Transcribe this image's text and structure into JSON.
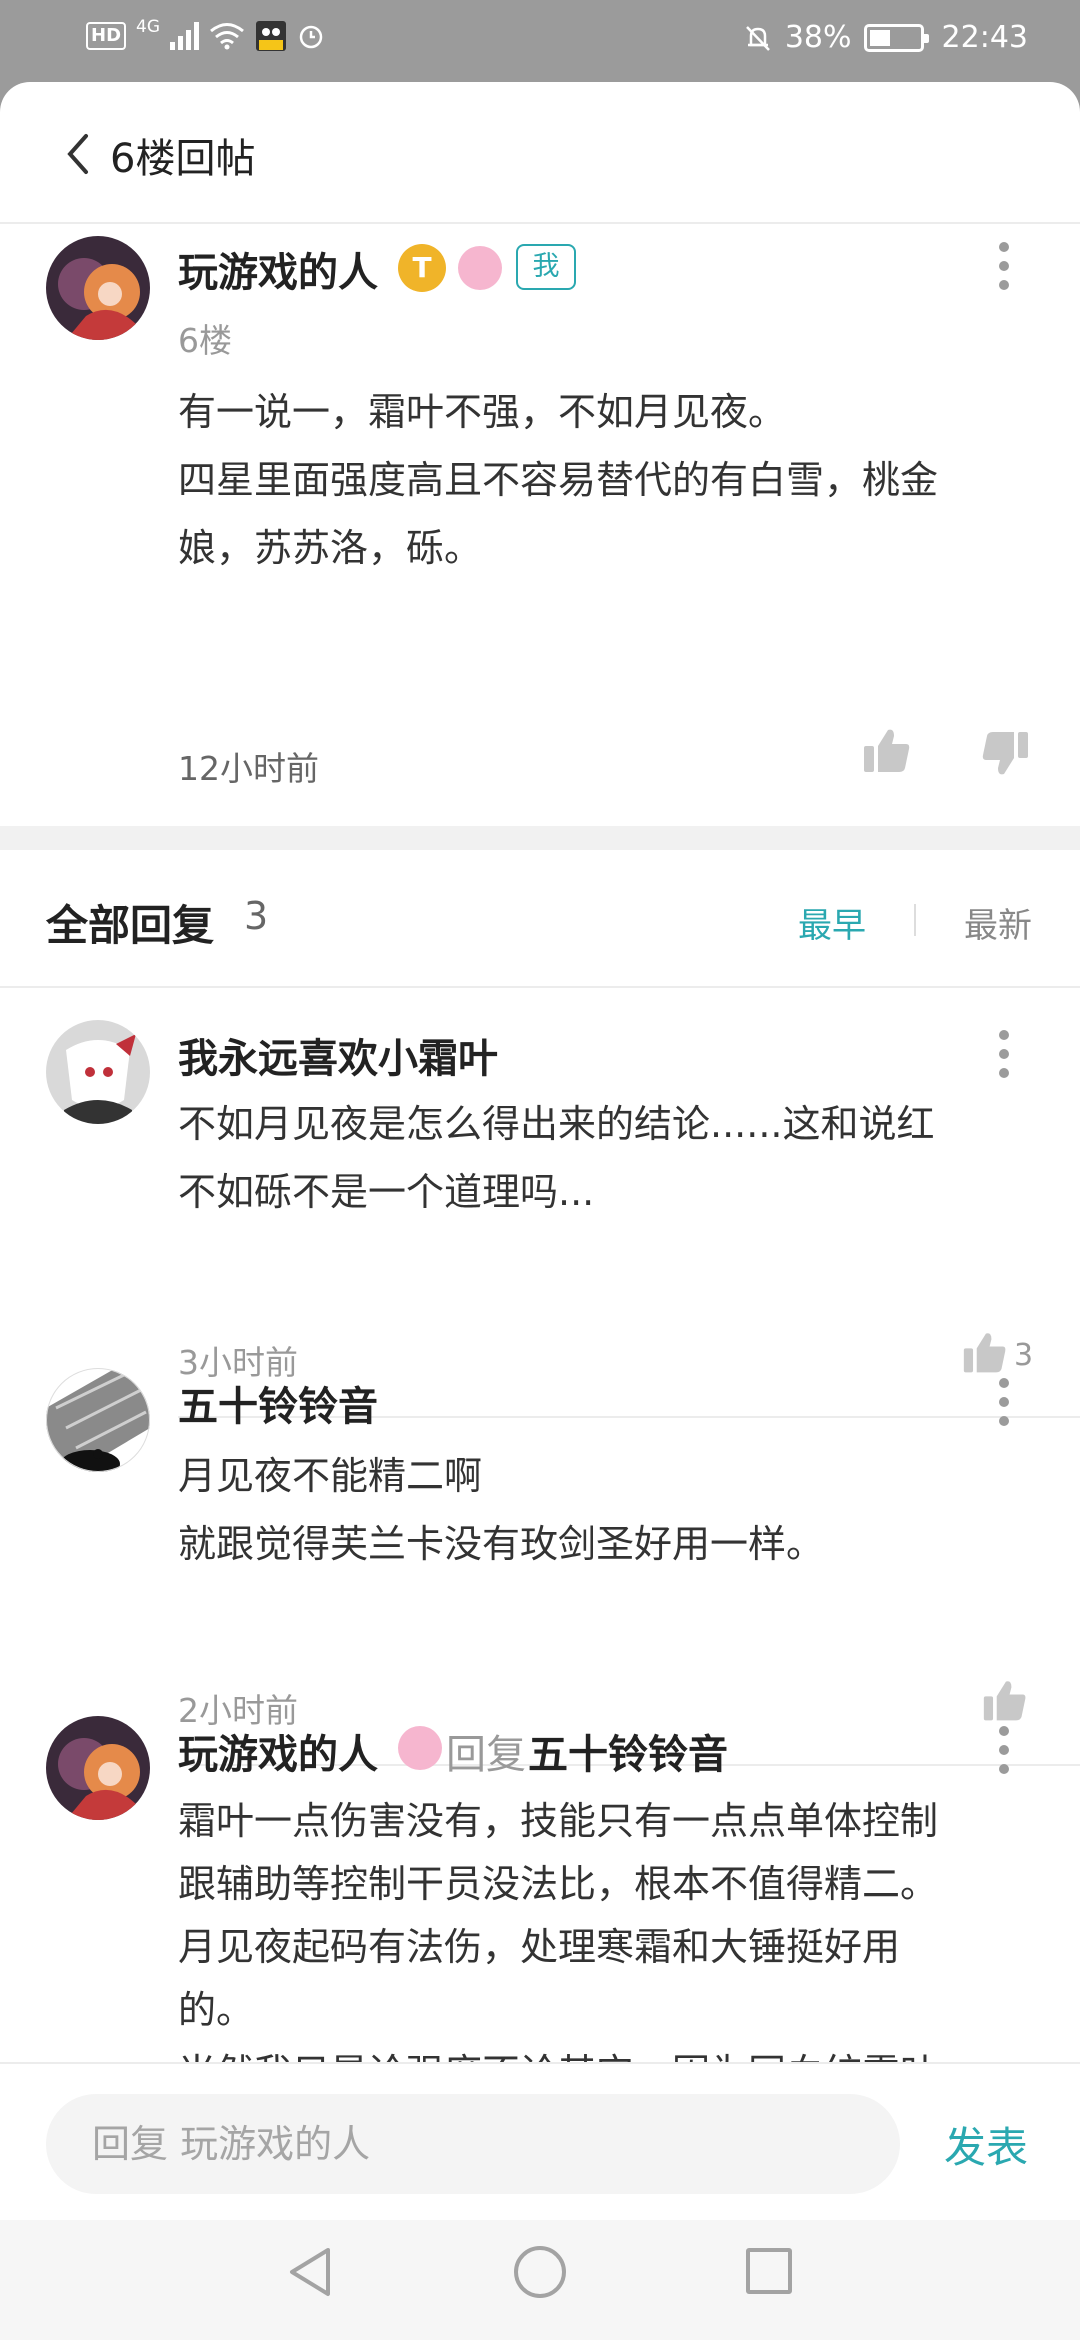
{
  "status_bar": {
    "hd": "HD",
    "network": "4G",
    "battery": "38%",
    "time": "22:43"
  },
  "header": {
    "title": "6楼回帖"
  },
  "post": {
    "author": "玩游戏的人",
    "t_badge": "T",
    "me_badge": "我",
    "floor": "6楼",
    "lines": [
      "有一说一，霜叶不强，不如月见夜。",
      "四星里面强度高且不容易替代的有白雪，桃金",
      "娘，苏苏洛，砾。"
    ],
    "time": "12小时前"
  },
  "replies_header": {
    "title": "全部回复",
    "count": "3",
    "sort_earliest": "最早",
    "sort_newest": "最新"
  },
  "replies": [
    {
      "author": "我永远喜欢小霜叶",
      "lines": [
        "不如月见夜是怎么得出来的结论......这和说红",
        "不如砾不是一个道理吗..."
      ],
      "time": "3小时前",
      "likes": "3"
    },
    {
      "author": "五十铃铃音",
      "lines": [
        "月见夜不能精二啊",
        "就跟觉得芙兰卡没有玫剑圣好用一样。"
      ],
      "time": "2小时前"
    },
    {
      "author": "玩游戏的人",
      "reply_word": "回复",
      "reply_to": "五十铃铃音",
      "lines": [
        "霜叶一点伤害没有，技能只有一点点单体控制",
        "跟辅助等控制干员没法比，根本不值得精二。",
        "月见夜起码有法伤，处理寒霜和大锤挺好用",
        "的。",
        "当然我只是论强度不论其它，因为同血统霜叶"
      ]
    }
  ],
  "composer": {
    "placeholder": "回复 玩游戏的人",
    "send_label": "发表"
  },
  "colors": {
    "accent": "#2aa8b0",
    "status_bar_bg": "#9b9b9b"
  }
}
